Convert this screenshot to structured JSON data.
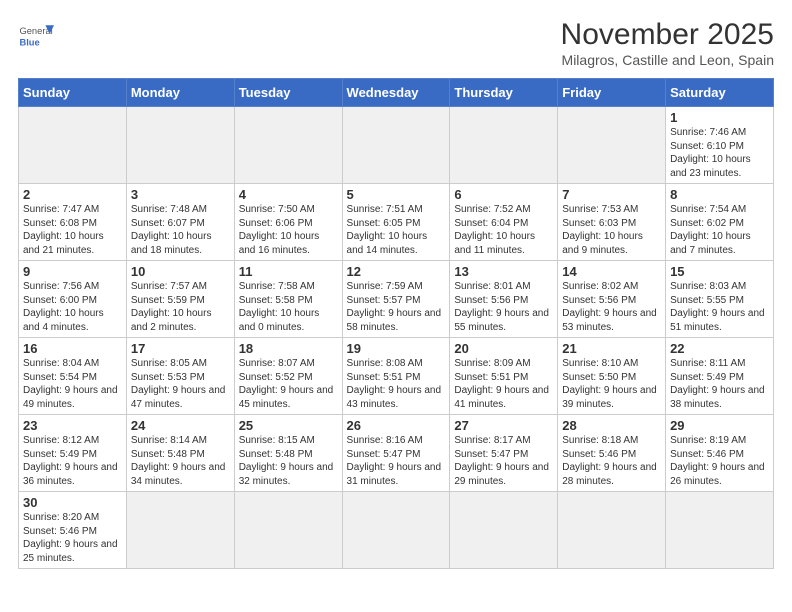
{
  "header": {
    "logo_general": "General",
    "logo_blue": "Blue",
    "month_title": "November 2025",
    "subtitle": "Milagros, Castille and Leon, Spain"
  },
  "weekdays": [
    "Sunday",
    "Monday",
    "Tuesday",
    "Wednesday",
    "Thursday",
    "Friday",
    "Saturday"
  ],
  "rows": [
    [
      {
        "day": "",
        "info": ""
      },
      {
        "day": "",
        "info": ""
      },
      {
        "day": "",
        "info": ""
      },
      {
        "day": "",
        "info": ""
      },
      {
        "day": "",
        "info": ""
      },
      {
        "day": "",
        "info": ""
      },
      {
        "day": "1",
        "info": "Sunrise: 7:46 AM\nSunset: 6:10 PM\nDaylight: 10 hours and 23 minutes."
      }
    ],
    [
      {
        "day": "2",
        "info": "Sunrise: 7:47 AM\nSunset: 6:08 PM\nDaylight: 10 hours and 21 minutes."
      },
      {
        "day": "3",
        "info": "Sunrise: 7:48 AM\nSunset: 6:07 PM\nDaylight: 10 hours and 18 minutes."
      },
      {
        "day": "4",
        "info": "Sunrise: 7:50 AM\nSunset: 6:06 PM\nDaylight: 10 hours and 16 minutes."
      },
      {
        "day": "5",
        "info": "Sunrise: 7:51 AM\nSunset: 6:05 PM\nDaylight: 10 hours and 14 minutes."
      },
      {
        "day": "6",
        "info": "Sunrise: 7:52 AM\nSunset: 6:04 PM\nDaylight: 10 hours and 11 minutes."
      },
      {
        "day": "7",
        "info": "Sunrise: 7:53 AM\nSunset: 6:03 PM\nDaylight: 10 hours and 9 minutes."
      },
      {
        "day": "8",
        "info": "Sunrise: 7:54 AM\nSunset: 6:02 PM\nDaylight: 10 hours and 7 minutes."
      }
    ],
    [
      {
        "day": "9",
        "info": "Sunrise: 7:56 AM\nSunset: 6:00 PM\nDaylight: 10 hours and 4 minutes."
      },
      {
        "day": "10",
        "info": "Sunrise: 7:57 AM\nSunset: 5:59 PM\nDaylight: 10 hours and 2 minutes."
      },
      {
        "day": "11",
        "info": "Sunrise: 7:58 AM\nSunset: 5:58 PM\nDaylight: 10 hours and 0 minutes."
      },
      {
        "day": "12",
        "info": "Sunrise: 7:59 AM\nSunset: 5:57 PM\nDaylight: 9 hours and 58 minutes."
      },
      {
        "day": "13",
        "info": "Sunrise: 8:01 AM\nSunset: 5:56 PM\nDaylight: 9 hours and 55 minutes."
      },
      {
        "day": "14",
        "info": "Sunrise: 8:02 AM\nSunset: 5:56 PM\nDaylight: 9 hours and 53 minutes."
      },
      {
        "day": "15",
        "info": "Sunrise: 8:03 AM\nSunset: 5:55 PM\nDaylight: 9 hours and 51 minutes."
      }
    ],
    [
      {
        "day": "16",
        "info": "Sunrise: 8:04 AM\nSunset: 5:54 PM\nDaylight: 9 hours and 49 minutes."
      },
      {
        "day": "17",
        "info": "Sunrise: 8:05 AM\nSunset: 5:53 PM\nDaylight: 9 hours and 47 minutes."
      },
      {
        "day": "18",
        "info": "Sunrise: 8:07 AM\nSunset: 5:52 PM\nDaylight: 9 hours and 45 minutes."
      },
      {
        "day": "19",
        "info": "Sunrise: 8:08 AM\nSunset: 5:51 PM\nDaylight: 9 hours and 43 minutes."
      },
      {
        "day": "20",
        "info": "Sunrise: 8:09 AM\nSunset: 5:51 PM\nDaylight: 9 hours and 41 minutes."
      },
      {
        "day": "21",
        "info": "Sunrise: 8:10 AM\nSunset: 5:50 PM\nDaylight: 9 hours and 39 minutes."
      },
      {
        "day": "22",
        "info": "Sunrise: 8:11 AM\nSunset: 5:49 PM\nDaylight: 9 hours and 38 minutes."
      }
    ],
    [
      {
        "day": "23",
        "info": "Sunrise: 8:12 AM\nSunset: 5:49 PM\nDaylight: 9 hours and 36 minutes."
      },
      {
        "day": "24",
        "info": "Sunrise: 8:14 AM\nSunset: 5:48 PM\nDaylight: 9 hours and 34 minutes."
      },
      {
        "day": "25",
        "info": "Sunrise: 8:15 AM\nSunset: 5:48 PM\nDaylight: 9 hours and 32 minutes."
      },
      {
        "day": "26",
        "info": "Sunrise: 8:16 AM\nSunset: 5:47 PM\nDaylight: 9 hours and 31 minutes."
      },
      {
        "day": "27",
        "info": "Sunrise: 8:17 AM\nSunset: 5:47 PM\nDaylight: 9 hours and 29 minutes."
      },
      {
        "day": "28",
        "info": "Sunrise: 8:18 AM\nSunset: 5:46 PM\nDaylight: 9 hours and 28 minutes."
      },
      {
        "day": "29",
        "info": "Sunrise: 8:19 AM\nSunset: 5:46 PM\nDaylight: 9 hours and 26 minutes."
      }
    ],
    [
      {
        "day": "30",
        "info": "Sunrise: 8:20 AM\nSunset: 5:46 PM\nDaylight: 9 hours and 25 minutes."
      },
      {
        "day": "",
        "info": ""
      },
      {
        "day": "",
        "info": ""
      },
      {
        "day": "",
        "info": ""
      },
      {
        "day": "",
        "info": ""
      },
      {
        "day": "",
        "info": ""
      },
      {
        "day": "",
        "info": ""
      }
    ]
  ]
}
